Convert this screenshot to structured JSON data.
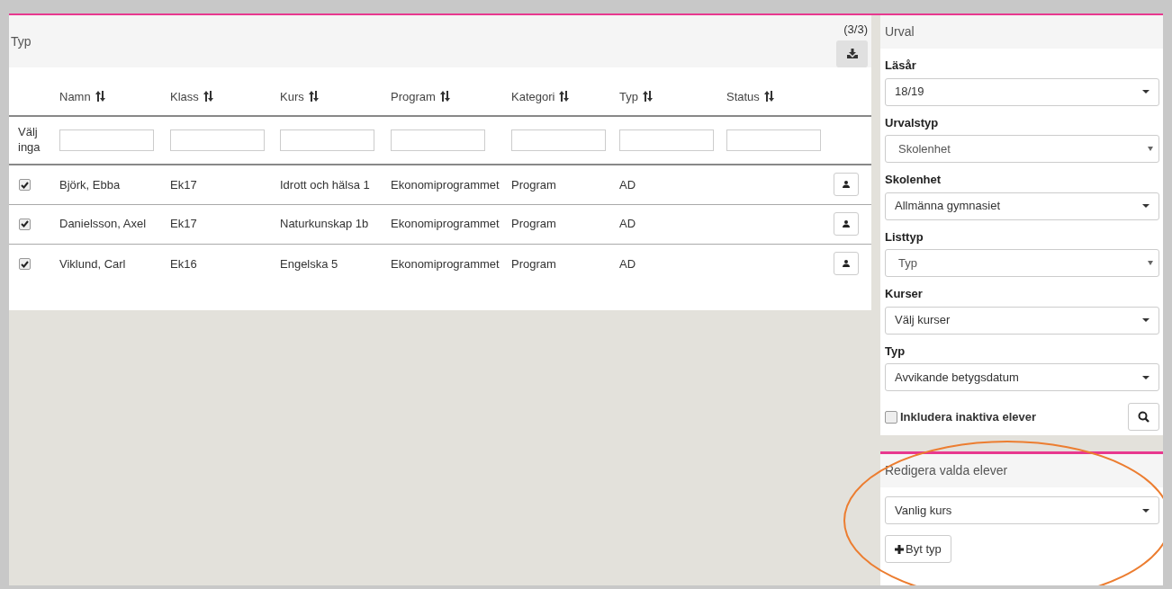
{
  "results": {
    "title": "Typ",
    "count": "(3/3)",
    "columns": [
      {
        "label": "Namn"
      },
      {
        "label": "Klass"
      },
      {
        "label": "Kurs"
      },
      {
        "label": "Program"
      },
      {
        "label": "Kategori"
      },
      {
        "label": "Typ"
      },
      {
        "label": "Status"
      }
    ],
    "select_none": "Välj inga",
    "rows": [
      {
        "checked": true,
        "cells": [
          "Björk, Ebba",
          "Ek17",
          "Idrott och hälsa 1",
          "Ekonomiprogrammet",
          "Program",
          "AD"
        ]
      },
      {
        "checked": true,
        "cells": [
          "Danielsson, Axel",
          "Ek17",
          "Naturkunskap 1b",
          "Ekonomiprogrammet",
          "Program",
          "AD"
        ]
      },
      {
        "checked": true,
        "cells": [
          "Viklund, Carl",
          "Ek16",
          "Engelska 5",
          "Ekonomiprogrammet",
          "Program",
          "AD"
        ]
      }
    ]
  },
  "selection": {
    "title": "Urval",
    "fields": [
      {
        "label": "Läsår",
        "value": "18/19",
        "kind": "dropdown"
      },
      {
        "label": "Urvalstyp",
        "value": "Skolenhet",
        "kind": "native"
      },
      {
        "label": "Skolenhet",
        "value": "Allmänna gymnasiet",
        "kind": "dropdown"
      },
      {
        "label": "Listtyp",
        "value": "Typ",
        "kind": "native"
      },
      {
        "label": "Kurser",
        "value": "Välj kurser",
        "kind": "dropdown"
      },
      {
        "label": "Typ",
        "value": "Avvikande betygsdatum",
        "kind": "dropdown"
      }
    ],
    "include_inactive": {
      "label": "Inkludera inaktiva elever",
      "checked": false
    }
  },
  "edit": {
    "title": "Redigera valda elever",
    "value": "Vanlig kurs",
    "button": "Byt typ"
  }
}
